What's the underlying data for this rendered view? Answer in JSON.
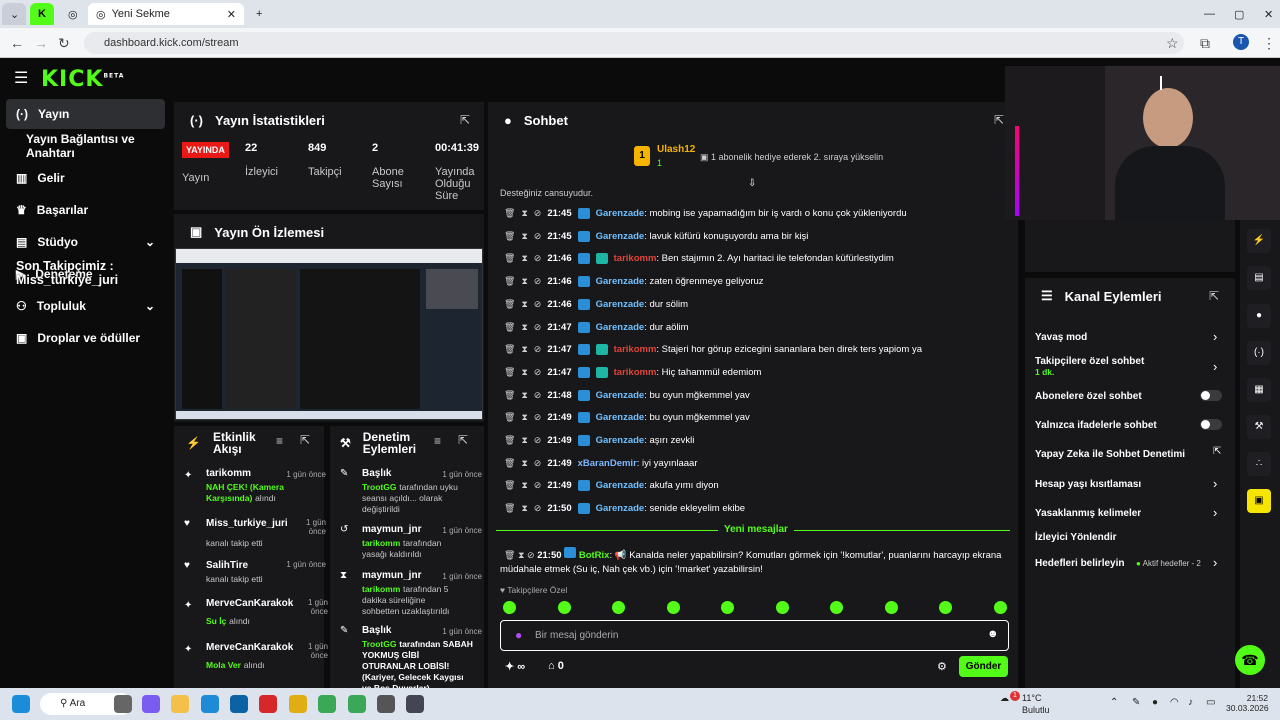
{
  "browser": {
    "tab_title": "Yeni Sekme",
    "url": "dashboard.kick.com/stream",
    "profile_initial": "T"
  },
  "kick": {
    "logo": "KICK",
    "logo_sup": "BETA"
  },
  "sidebar": {
    "items": [
      {
        "label": "Yayın",
        "icon": "broadcast-icon"
      },
      {
        "label": "Yayın Bağlantısı ve Anahtarı"
      },
      {
        "label": "Gelir",
        "icon": "chart-icon"
      },
      {
        "label": "Başarılar",
        "icon": "trophy-icon"
      },
      {
        "label": "Stüdyo",
        "icon": "studio-icon"
      },
      {
        "label": "Deneteme",
        "icon": "play-icon"
      },
      {
        "label": "Topluluk",
        "icon": "people-icon"
      },
      {
        "label": "Droplar ve ödüller",
        "icon": "gift-icon"
      }
    ],
    "overlay_text": "Son Takipçimiz : Miss_turkiye_juri"
  },
  "stats": {
    "title": "Yayın İstatistikleri",
    "live_badge": "YAYINDA",
    "live_label": "Yayın",
    "viewers": "22",
    "viewers_label": "İzleyici",
    "followers": "849",
    "followers_label": "Takipçi",
    "subs": "2",
    "subs_label": "Abone Sayısı",
    "duration": "00:41:39",
    "duration_label": "Yayında Olduğu Süre"
  },
  "preview": {
    "title": "Yayın Ön İzlemesi"
  },
  "activity": {
    "title": "Etkinlik Akışı",
    "items": [
      {
        "name": "tarikomm",
        "time": "1 gün önce",
        "detail": "NAH ÇEK! (Kamera Karşısında)",
        "suffix": "alındı"
      },
      {
        "name": "Miss_turkiye_juri",
        "time": "1 gün önce",
        "detail": "",
        "suffix": "kanalı takip etti"
      },
      {
        "name": "SalihTire",
        "time": "1 gün önce",
        "detail": "",
        "suffix": "kanalı takip etti"
      },
      {
        "name": "MerveCanKarakok",
        "time": "1 gün önce",
        "detail": "Su İç",
        "suffix": "alındı"
      },
      {
        "name": "MerveCanKarakok",
        "time": "1 gün önce",
        "detail": "Mola Ver",
        "suffix": "alındı"
      }
    ]
  },
  "moderation": {
    "title": "Denetim Eylemleri",
    "items": [
      {
        "name": "Başlık",
        "time": "1 gün önce",
        "actor": "TrootGG",
        "text": "tarafından uyku seansı açıldı... olarak değiştirildi"
      },
      {
        "name": "maymun_jnr",
        "time": "1 gün önce",
        "actor": "tarikomm",
        "text": "tarafından yasağı kaldırıldı"
      },
      {
        "name": "maymun_jnr",
        "time": "1 gün önce",
        "actor": "tarikomm",
        "text": "tarafından 5 dakika süreliğine sohbetten uzaklaştırıldı"
      },
      {
        "name": "Başlık",
        "time": "1 gün önce",
        "actor": "TrootGG",
        "text": "tarafından SABAH YOKMUŞ GİBİ OTURANLAR LOBİSİ! (Kariyer, Gelecek Kaygısı ve Boş Duvarlar)"
      }
    ]
  },
  "chat": {
    "title": "Sohbet",
    "pinned_user": "Ulash12",
    "pinned_count": "1",
    "pinned_text": "1 abonelik hediye ederek 2. sıraya yükselin",
    "truncated_top": "Desteğiniz cansuyudur.",
    "messages": [
      {
        "time": "21:45",
        "user": "Garenzade",
        "style": "g",
        "text": "mobing ise yapamadığım bir iş vardı o konu çok yükleniyordu"
      },
      {
        "time": "21:45",
        "user": "Garenzade",
        "style": "g",
        "text": "lavuk küfürü konuşuyordu ama bir kişi"
      },
      {
        "time": "21:46",
        "user": "tarikomm",
        "style": "r",
        "text": "Ben stajımın 2. Ayı haritaci ile telefondan küfürlestiydim"
      },
      {
        "time": "21:46",
        "user": "Garenzade",
        "style": "g",
        "text": "zaten öğrenmeye geliyoruz"
      },
      {
        "time": "21:46",
        "user": "Garenzade",
        "style": "g",
        "text": "dur sölim"
      },
      {
        "time": "21:47",
        "user": "Garenzade",
        "style": "g",
        "text": "dur aölim"
      },
      {
        "time": "21:47",
        "user": "tarikomm",
        "style": "r",
        "text": "Stajeri hor görup ezicegini sananlara ben direk ters yapiom ya"
      },
      {
        "time": "21:47",
        "user": "tarikomm",
        "style": "r",
        "text": "Hiç tahammül edemiom"
      },
      {
        "time": "21:48",
        "user": "Garenzade",
        "style": "g",
        "text": "bu oyun mğkemmel yav"
      },
      {
        "time": "21:49",
        "user": "Garenzade",
        "style": "g",
        "text": "bu oyun mğkemmel yav"
      },
      {
        "time": "21:49",
        "user": "Garenzade",
        "style": "g",
        "text": "aşırı zevkli"
      },
      {
        "time": "21:49",
        "user": "xBaranDemir",
        "style": "b",
        "text": "iyi yayınlaaar"
      },
      {
        "time": "21:49",
        "user": "Garenzade",
        "style": "g",
        "text": "akufa yımı diyon"
      },
      {
        "time": "21:50",
        "user": "Garenzade",
        "style": "g",
        "text": "senide ekleyelim ekibe"
      }
    ],
    "new_messages": "Yeni mesajlar",
    "bot_time": "21:50",
    "bot_user": "BotRix",
    "bot_text": "Kanalda neler yapabilirsin? Komutları görmek için '!komutlar', puanlarını harcayıp ekrana",
    "bot_text2": "müdahale etmek (Su iç, Nah çek vb.) için '!market' yazabilirsin!",
    "followers_only": "Takipçilere Özel",
    "input_placeholder": "Bir mesaj gönderin",
    "points": "0",
    "infinity": "∞",
    "send": "Gönder"
  },
  "channel_actions": {
    "title": "Kanal Eylemleri",
    "slow_mode": "Yavaş mod",
    "followers_chat": "Takipçilere özel sohbet",
    "followers_chat_sub": "1 dk.",
    "subs_chat": "Abonelere özel sohbet",
    "emote_chat": "Yalnızca ifadelerle sohbet",
    "ai_mod": "Yapay Zeka ile Sohbet Denetimi",
    "age_limits": "Hesap yaşı kısıtlaması",
    "banned_words": "Yasaklanmış kelimeler",
    "redirect": "İzleyici Yönlendir",
    "goals": "Hedefleri belirleyin",
    "goals_status": "Aktif hedefler - 2"
  },
  "taskbar": {
    "search": "Ara",
    "weather_temp": "11°C",
    "weather_desc": "Bulutlu",
    "time": "21:52",
    "date": "30.03.2026",
    "notif": "1"
  }
}
